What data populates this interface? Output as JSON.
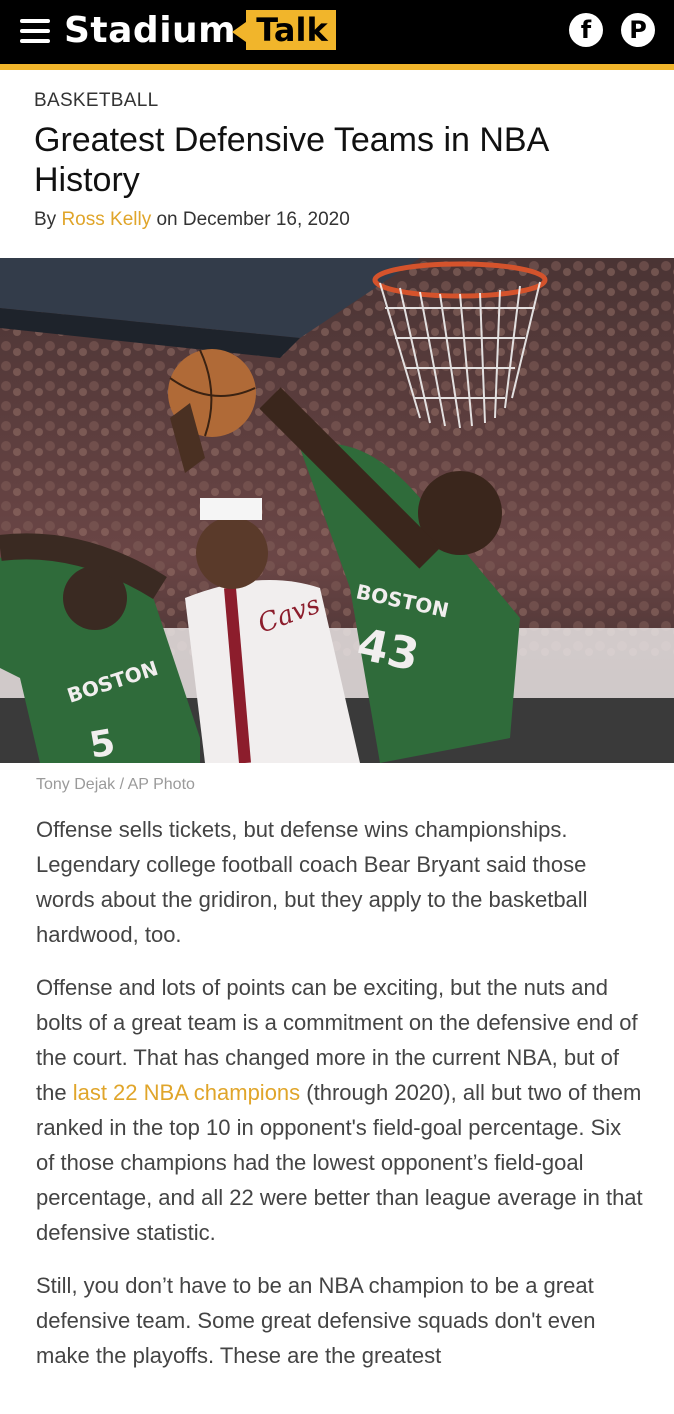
{
  "header": {
    "logo_word": "Stadium",
    "logo_tag": "Talk",
    "accent": "#f1b52b",
    "menu_icon": "hamburger-menu-icon",
    "social": [
      {
        "name": "facebook-icon",
        "glyph": "f"
      },
      {
        "name": "pinterest-icon",
        "glyph": "P"
      }
    ]
  },
  "article": {
    "category": "BASKETBALL",
    "title": "Greatest Defensive Teams in NBA History",
    "byline_by": "By ",
    "author": "Ross Kelly",
    "byline_on": " on December 16, 2020",
    "photo_credit": "Tony Dejak  /  AP Photo",
    "jersey_front": "Cavs",
    "jersey_right": "BOSTON",
    "jersey_right_number": "43",
    "jersey_left": "BOSTON",
    "jersey_left_number": "5",
    "paragraphs": [
      {
        "text": "Offense sells tickets, but defense wins championships. Legendary college football coach Bear Bryant said those words about the gridiron, but they apply to the basketball hardwood, too."
      },
      {
        "before": "Offense and lots of points can be exciting, but the nuts and bolts of a great team is a commitment on the defensive end of the court. That has changed more in the current NBA, but of the ",
        "link": "last 22 NBA champions",
        "after": " (through 2020), all but two of them ranked in the top 10 in opponent's field-goal percentage. Six of those champions had the lowest opponent’s field-goal percentage, and all 22 were better than league average in that defensive statistic."
      },
      {
        "text": "Still, you don’t have to be an NBA champion to be a great defensive team. Some great defensive squads don't even make the playoffs. These are the greatest"
      }
    ]
  }
}
